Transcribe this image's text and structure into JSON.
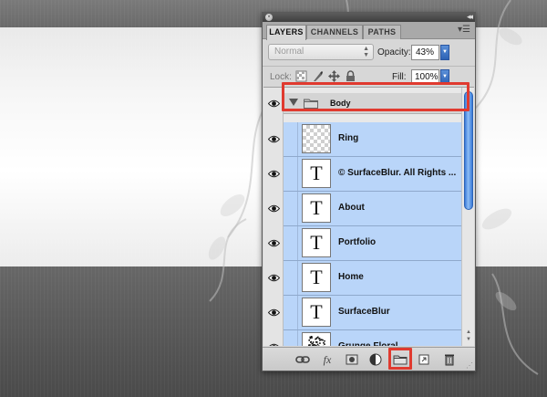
{
  "panel": {
    "tabs": [
      "LAYERS",
      "CHANNELS",
      "PATHS"
    ],
    "active_tab": "LAYERS",
    "blend_mode": "Normal",
    "opacity_label": "Opacity:",
    "opacity_value": "43%",
    "lock_label": "Lock:",
    "fill_label": "Fill:",
    "fill_value": "100%"
  },
  "group": {
    "name": "Body",
    "expanded": true
  },
  "layers": [
    {
      "name": "Ring",
      "thumb": "transparent"
    },
    {
      "name": "© SurfaceBlur.  All Rights ...",
      "thumb": "text"
    },
    {
      "name": "About",
      "thumb": "text"
    },
    {
      "name": "Portfolio",
      "thumb": "text"
    },
    {
      "name": "Home",
      "thumb": "text"
    },
    {
      "name": "SurfaceBlur",
      "thumb": "text"
    },
    {
      "name": "Grunge Floral",
      "thumb": "image"
    }
  ],
  "text_glyph": "T",
  "toolbar": {
    "icons": [
      "link-layers-icon",
      "fx-icon",
      "add-mask-icon",
      "adjustment-layer-icon",
      "new-group-icon",
      "new-layer-icon",
      "trash-icon"
    ],
    "fx_label": "fx"
  },
  "colors": {
    "selection": "#b9d5f9",
    "highlight": "#e03a2f",
    "scroll_thumb": "#3b7bd8"
  }
}
